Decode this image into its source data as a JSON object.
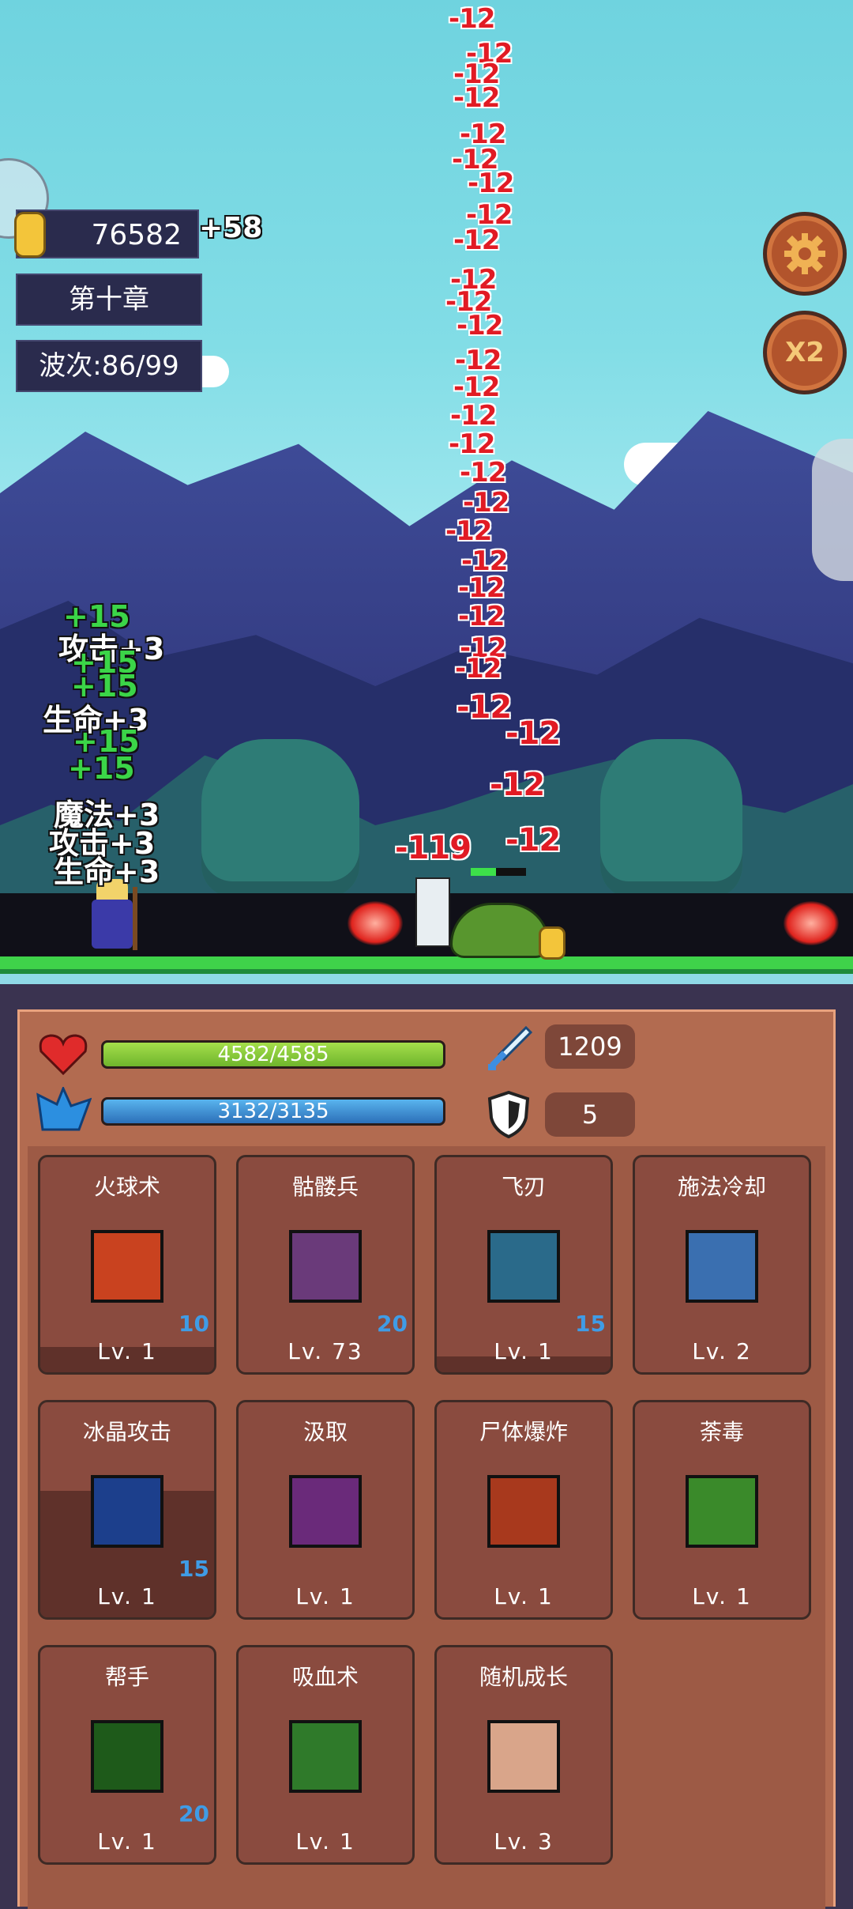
{
  "hud": {
    "gold": "76582",
    "gold_gain": "+58",
    "chapter": "第十章",
    "wave": "波次:86/99",
    "speed_label": "X2"
  },
  "battle_text": {
    "damage": [
      "-12",
      "-12",
      "-12",
      "-12",
      "-12",
      "-12",
      "-12",
      "-12",
      "-12",
      "-12",
      "-12",
      "-12",
      "-12",
      "-12",
      "-12",
      "-12",
      "-12",
      "-12",
      "-12",
      "-12",
      "-12",
      "-12",
      "-12",
      "-12",
      "-12",
      "-12",
      "-12",
      "-12"
    ],
    "big_hit": "-119",
    "buffs": [
      "+15",
      "攻击+3",
      "+15",
      "+15",
      "生命+3",
      "+15",
      "+15",
      "魔法+3",
      "攻击+3",
      "生命+3"
    ]
  },
  "stats": {
    "hp": "4582/4585",
    "hp_fraction": 0.9993,
    "mp": "3132/3135",
    "mp_fraction": 0.999,
    "attack": "1209",
    "defense": "5"
  },
  "skills": [
    {
      "name": "火球术",
      "count": "10",
      "level": "Lv. 1",
      "icon": "fireball-icon",
      "color": "#c9421f",
      "cooldown": 0.08
    },
    {
      "name": "骷髅兵",
      "count": "20",
      "level": "Lv. 73",
      "icon": "skeleton-hand-icon",
      "color": "#6a3a7a",
      "cooldown": 0
    },
    {
      "name": "飞刃",
      "count": "15",
      "level": "Lv. 1",
      "icon": "flying-blade-icon",
      "color": "#2a6a8a",
      "cooldown": 0.05
    },
    {
      "name": "施法冷却",
      "count": "",
      "level": "Lv. 2",
      "icon": "lightning-icon",
      "color": "#3a6fb0",
      "cooldown": 0
    },
    {
      "name": "冰晶攻击",
      "count": "15",
      "level": "Lv. 1",
      "icon": "ice-crystal-icon",
      "color": "#1c3f8c",
      "cooldown": 0.6
    },
    {
      "name": "汲取",
      "count": "",
      "level": "Lv. 1",
      "icon": "spiral-icon",
      "color": "#6a2a7a",
      "cooldown": 0
    },
    {
      "name": "尸体爆炸",
      "count": "",
      "level": "Lv. 1",
      "icon": "explosion-icon",
      "color": "#a8391d",
      "cooldown": 0
    },
    {
      "name": "荼毒",
      "count": "",
      "level": "Lv. 1",
      "icon": "poison-icon",
      "color": "#3a8a2a",
      "cooldown": 0
    },
    {
      "name": "帮手",
      "count": "20",
      "level": "Lv. 1",
      "icon": "slime-helper-icon",
      "color": "#1e5a1a",
      "cooldown": 0
    },
    {
      "name": "吸血术",
      "count": "",
      "level": "Lv. 1",
      "icon": "heart-drain-icon",
      "color": "#2f7a2a",
      "cooldown": 0
    },
    {
      "name": "随机成长",
      "count": "",
      "level": "Lv. 3",
      "icon": "fist-icon",
      "color": "#d9a58a",
      "cooldown": 0
    }
  ]
}
